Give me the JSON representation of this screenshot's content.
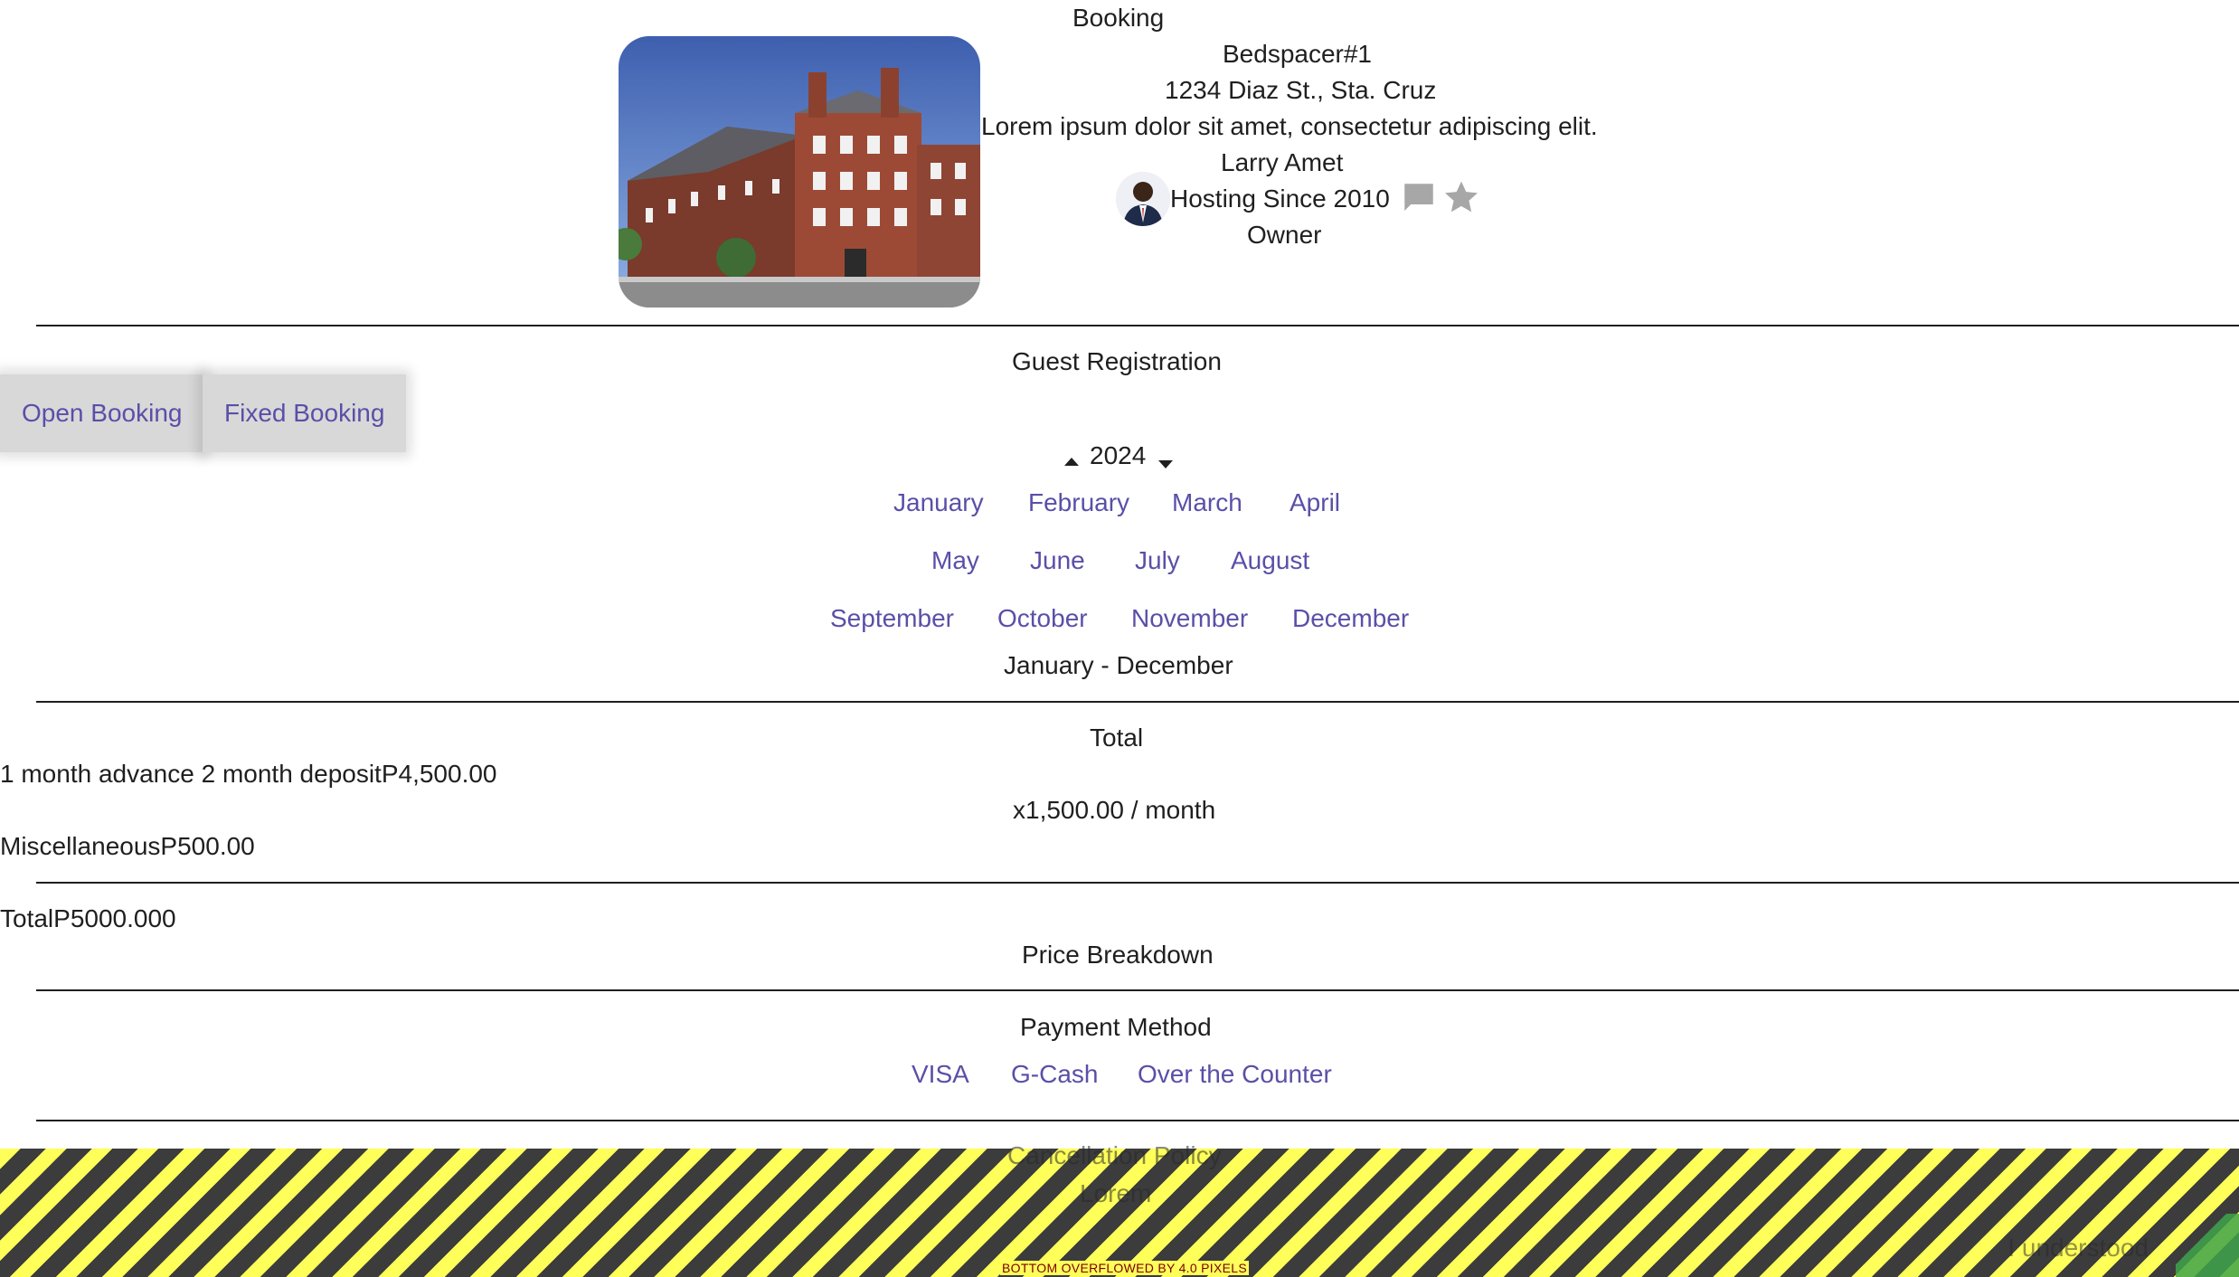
{
  "header": {
    "title": "Booking"
  },
  "listing": {
    "name": "Bedspacer#1",
    "address": "1234 Diaz St., Sta. Cruz",
    "description": "Lorem ipsum dolor sit amet, consectetur adipiscing elit.",
    "host_name": "Larry Amet",
    "hosting_since": "Hosting Since 2010",
    "host_role": "Owner",
    "icons": [
      "chat-icon",
      "star-icon"
    ]
  },
  "registration": {
    "title": "Guest Registration",
    "booking_types": [
      "Open Booking",
      "Fixed Booking"
    ],
    "year": "2024",
    "months_row1": [
      "January",
      "February",
      "March",
      "April"
    ],
    "months_row2": [
      "May",
      "June",
      "July",
      "August"
    ],
    "months_row3": [
      "September",
      "October",
      "November",
      "December"
    ],
    "range": "January - December"
  },
  "total": {
    "title": "Total",
    "advance_line": "1 month advance 2 month depositP4,500.00",
    "rate": "x1,500.00 / month",
    "misc_line": "MiscellaneousP500.00",
    "total_line": "TotalP5000.000",
    "breakdown_label": "Price Breakdown"
  },
  "payment": {
    "title": "Payment Method",
    "methods": [
      "VISA",
      "G-Cash",
      "Over the Counter"
    ]
  },
  "footer": {
    "cancellation_title": "Cancellation Policy",
    "cancellation_text": "Lorem",
    "understood": "I understood",
    "overflow_warning": "BOTTOM OVERFLOWED BY 4.0 PIXELS"
  },
  "colors": {
    "link": "#5a4fa8",
    "hazard_yellow": "#ffff5a",
    "hazard_dark": "#3c3c3c"
  }
}
